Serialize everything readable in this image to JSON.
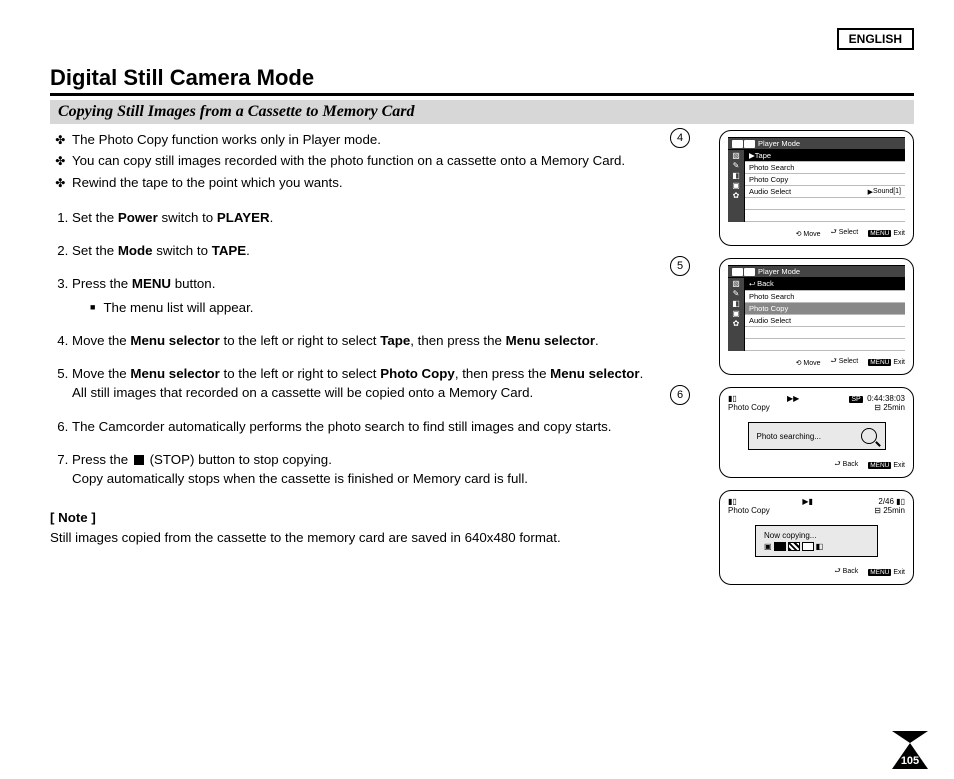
{
  "language_label": "ENGLISH",
  "title": "Digital Still Camera Mode",
  "subtitle": "Copying Still Images from a Cassette to Memory Card",
  "bullets": [
    "The Photo Copy function works only in Player mode.",
    "You can copy still images recorded with the photo function on a cassette onto a Memory Card.",
    "Rewind the tape to the point which you wants."
  ],
  "steps": {
    "s1a": "Set the ",
    "s1b": "Power",
    "s1c": " switch to ",
    "s1d": "PLAYER",
    "s1e": ".",
    "s2a": "Set the ",
    "s2b": "Mode",
    "s2c": " switch to ",
    "s2d": "TAPE",
    "s2e": ".",
    "s3a": "Press the ",
    "s3b": "MENU",
    "s3c": " button.",
    "s3_sub": "The menu list will appear.",
    "s4a": "Move the ",
    "s4b": "Menu selector",
    "s4c": " to the left or right to select ",
    "s4d": "Tape",
    "s4e": ", then press the ",
    "s4f": "Menu selector",
    "s4g": ".",
    "s5a": "Move the ",
    "s5b": "Menu selector",
    "s5c": " to the left or right to select ",
    "s5d": "Photo Copy",
    "s5e": ", then press the ",
    "s5f": "Menu selector",
    "s5g": ".",
    "s5_line2": "All still images that recorded on a cassette will be copied onto a Memory Card.",
    "s6": "The Camcorder automatically performs the photo search to find still images and copy starts.",
    "s7a": "Press the ",
    "s7b": "(STOP) button to stop copying.",
    "s7_line2": "Copy automatically stops when the cassette is finished or Memory card is full."
  },
  "note_heading": "[ Note ]",
  "note_text": "Still images copied from the cassette to the memory card are saved in 640x480 format.",
  "panel4": {
    "num": "4",
    "header": "Player Mode",
    "opt_tape": "Tape",
    "opt_search": "Photo Search",
    "opt_copy": "Photo Copy",
    "opt_audio": "Audio Select",
    "side_val": "Sound[1]",
    "hint_move": "Move",
    "hint_select": "Select",
    "hint_exit": "Exit",
    "btn_menu": "MENU"
  },
  "panel5": {
    "num": "5",
    "header": "Player Mode",
    "opt_back": "Back",
    "opt_search": "Photo Search",
    "opt_copy": "Photo Copy",
    "opt_audio": "Audio Select",
    "hint_move": "Move",
    "hint_select": "Select",
    "hint_exit": "Exit",
    "btn_menu": "MENU"
  },
  "panel6": {
    "num": "6",
    "title": "Photo Copy",
    "sp": "SP",
    "time": "0:44:38:03",
    "remain": "25min",
    "search_text": "Photo searching...",
    "hint_back": "Back",
    "hint_exit": "Exit",
    "btn_menu": "MENU"
  },
  "panel7": {
    "title": "Photo Copy",
    "count": "2/46",
    "remain": "25min",
    "copy_text": "Now copying...",
    "hint_back": "Back",
    "hint_exit": "Exit",
    "btn_menu": "MENU"
  },
  "page_number": "105"
}
